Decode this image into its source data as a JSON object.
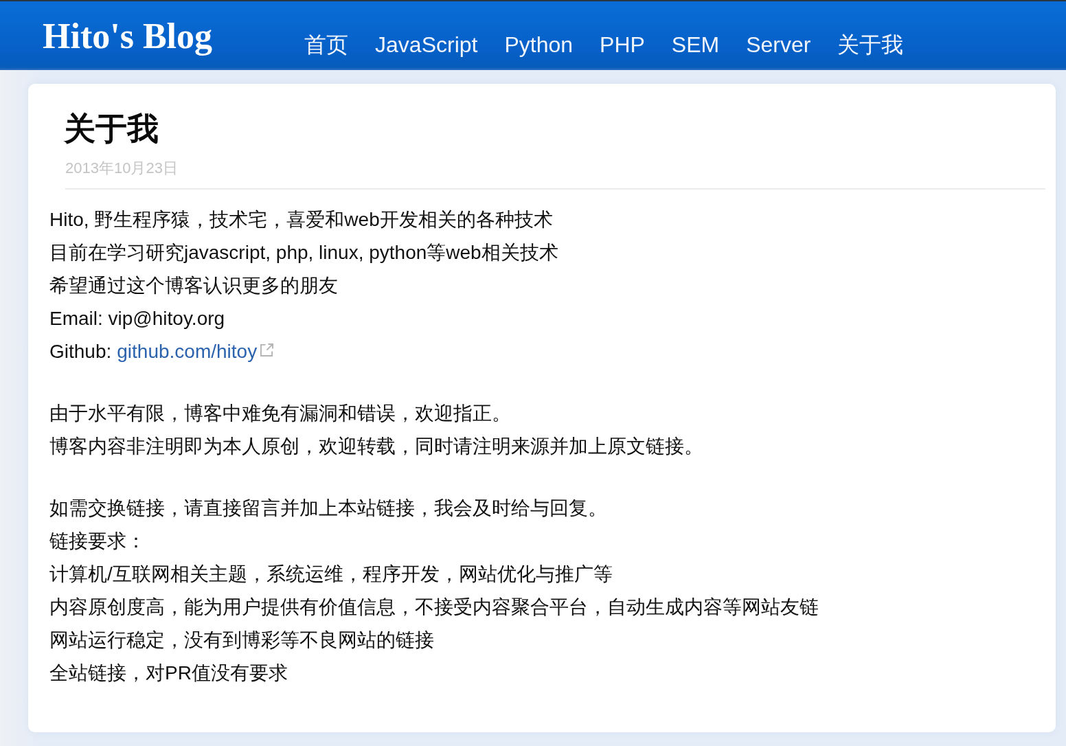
{
  "navbar": {
    "brand": "Hito's Blog",
    "items": [
      "首页",
      "JavaScript",
      "Python",
      "PHP",
      "SEM",
      "Server",
      "关于我"
    ]
  },
  "post": {
    "title": "关于我",
    "date": "2013年10月23日",
    "paragraphs": [
      {
        "lines": [
          {
            "kind": "text",
            "text": "Hito, 野生程序猿，技术宅，喜爱和web开发相关的各种技术"
          },
          {
            "kind": "text",
            "text": "目前在学习研究javascript, php, linux, python等web相关技术"
          },
          {
            "kind": "text",
            "text": "希望通过这个博客认识更多的朋友"
          },
          {
            "kind": "text",
            "text": "Email: vip@hitoy.org"
          },
          {
            "kind": "link",
            "label": "Github:",
            "link": "github.com/hitoy",
            "external": true
          }
        ]
      },
      {
        "lines": [
          {
            "kind": "text",
            "text": "由于水平有限，博客中难免有漏洞和错误，欢迎指正。"
          },
          {
            "kind": "text",
            "text": "博客内容非注明即为本人原创，欢迎转载，同时请注明来源并加上原文链接。"
          }
        ]
      },
      {
        "lines": [
          {
            "kind": "text",
            "text": "如需交换链接，请直接留言并加上本站链接，我会及时给与回复。"
          },
          {
            "kind": "text",
            "text": "链接要求："
          },
          {
            "kind": "text",
            "text": "计算机/互联网相关主题，系统运维，程序开发，网站优化与推广等"
          },
          {
            "kind": "text",
            "text": "内容原创度高，能为用户提供有价值信息，不接受内容聚合平台，自动生成内容等网站友链"
          },
          {
            "kind": "text",
            "text": "网站运行稳定，没有到博彩等不良网站的链接"
          },
          {
            "kind": "text",
            "text": "全站链接，对PR值没有要求"
          }
        ]
      }
    ]
  }
}
